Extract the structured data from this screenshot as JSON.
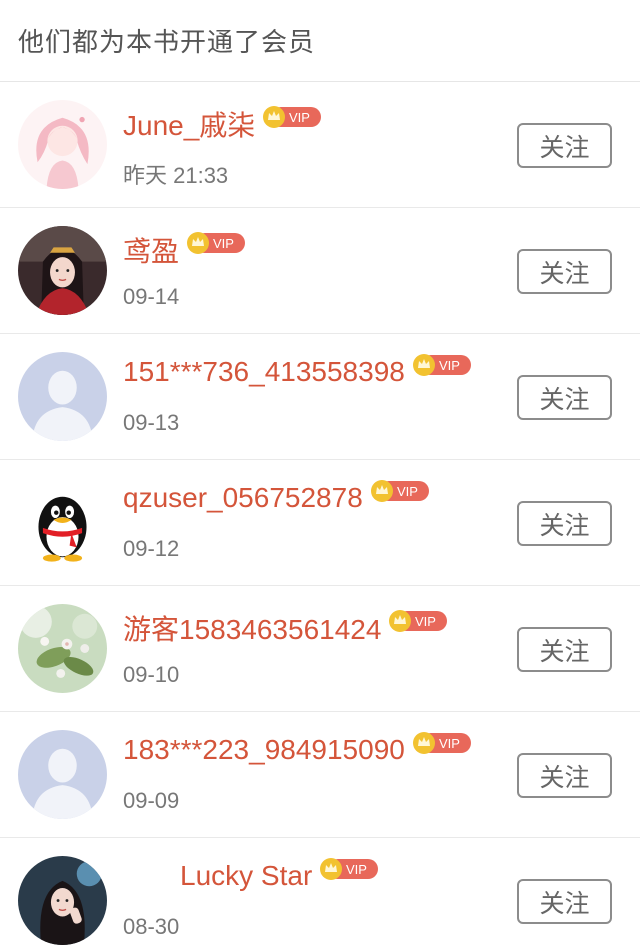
{
  "header": {
    "title": "他们都为本书开通了会员"
  },
  "vip_label": "VIP",
  "follow_label": "关注",
  "colors": {
    "name": "#d4553a",
    "vip_badge": "#e8685a",
    "crown": "#f2c230"
  },
  "members": [
    {
      "name": "June_戚柒",
      "time": "昨天 21:33",
      "avatar": "anime-girl-avatar"
    },
    {
      "name": "鸢盈",
      "time": "09-14",
      "avatar": "costume-portrait-avatar"
    },
    {
      "name": "151***736_413558398",
      "time": "09-13",
      "avatar": "default-person-avatar"
    },
    {
      "name": "qzuser_056752878",
      "time": "09-12",
      "avatar": "qq-penguin-avatar"
    },
    {
      "name": "游客1583463561424",
      "time": "09-10",
      "avatar": "flowers-avatar"
    },
    {
      "name": "183***223_984915090",
      "time": "09-09",
      "avatar": "default-person-avatar"
    },
    {
      "name": "Lucky Star",
      "time": "08-30",
      "avatar": "girl-photo-avatar"
    }
  ]
}
